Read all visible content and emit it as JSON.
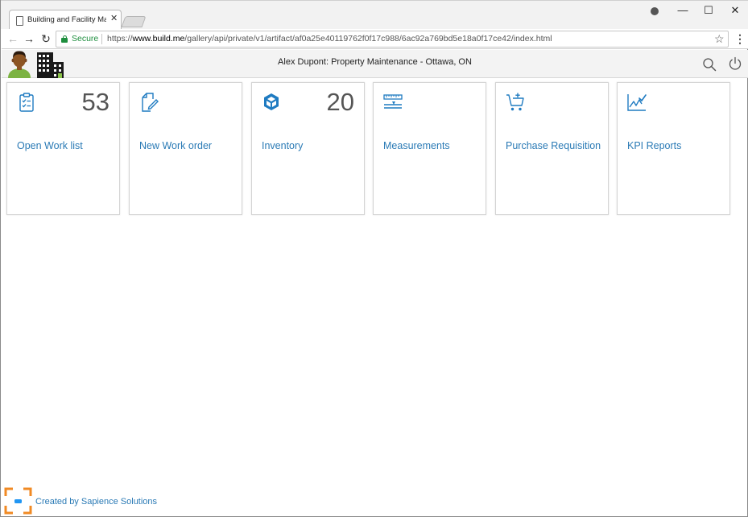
{
  "browser": {
    "tab_title": "Building and Facility Ma",
    "tab_close": "✕",
    "secure_label": "Secure",
    "url_scheme": "https://",
    "url_host": "www.build.me",
    "url_path": "/gallery/api/private/v1/artifact/af0a25e40119762f0f17c988/6ac92a769bd5e18a0f17ce42/index.html",
    "controls": {
      "minimize": "—",
      "maximize": "☐",
      "close": "✕"
    }
  },
  "header": {
    "title": "Alex Dupont: Property Maintenance - Ottawa, ON"
  },
  "tiles": [
    {
      "icon": "clipboard-checklist-icon",
      "label": "Open Work list",
      "count": "53"
    },
    {
      "icon": "edit-document-icon",
      "label": "New Work order",
      "count": ""
    },
    {
      "icon": "inventory-cubes-icon",
      "label": "Inventory",
      "count": "20"
    },
    {
      "icon": "measure-ruler-icon",
      "label": "Measurements",
      "count": ""
    },
    {
      "icon": "cart-add-icon",
      "label": "Purchase Requisition",
      "count": ""
    },
    {
      "icon": "kpi-chart-icon",
      "label": "KPI Reports",
      "count": ""
    }
  ],
  "footer": {
    "credit": "Created by Sapience Solutions"
  },
  "colors": {
    "accent": "#2a7ab5",
    "icon_blue": "#1f7bc1",
    "secure_green": "#1e8e3e",
    "footer_logo_orange": "#f08a24"
  }
}
